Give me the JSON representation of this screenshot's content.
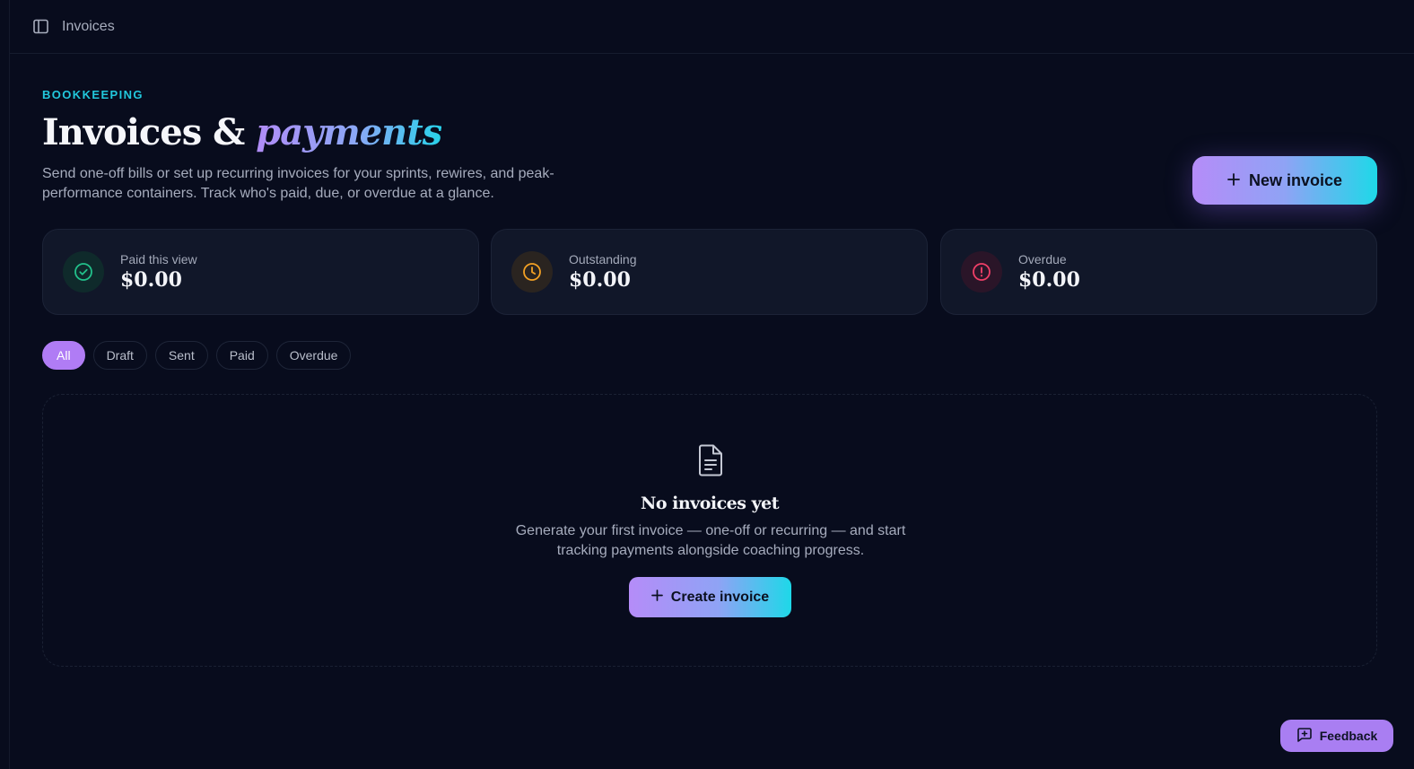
{
  "topbar": {
    "sidebar_toggle_icon": "sidebar-panel-icon",
    "title": "Invoices"
  },
  "header": {
    "eyebrow": "BOOKKEEPING",
    "title_main": "Invoices &",
    "title_accent": "payments",
    "subtitle": "Send one-off bills or set up recurring invoices for your sprints, rewires, and peak-performance containers. Track who's paid, due, or overdue at a glance.",
    "new_invoice_label": "New invoice",
    "new_invoice_icon": "plus-icon"
  },
  "stats": [
    {
      "label": "Paid this view",
      "value": "$0.00",
      "icon": "check-circle-icon",
      "color": "#22c08a"
    },
    {
      "label": "Outstanding",
      "value": "$0.00",
      "icon": "clock-icon",
      "color": "#f2a024"
    },
    {
      "label": "Overdue",
      "value": "$0.00",
      "icon": "alert-circle-icon",
      "color": "#ef3f67"
    }
  ],
  "filters": {
    "items": [
      "All",
      "Draft",
      "Sent",
      "Paid",
      "Overdue"
    ],
    "active": "All"
  },
  "empty_state": {
    "icon": "file-text-icon",
    "title": "No invoices yet",
    "description": "Generate your first invoice — one-off or recurring — and start tracking payments alongside coaching progress.",
    "button_label": "Create invoice"
  },
  "feedback": {
    "label": "Feedback",
    "icon": "message-plus-icon"
  },
  "colors": {
    "background": "#080c1d",
    "accent_purple": "#b07cf5",
    "accent_cyan": "#22c8dc"
  }
}
